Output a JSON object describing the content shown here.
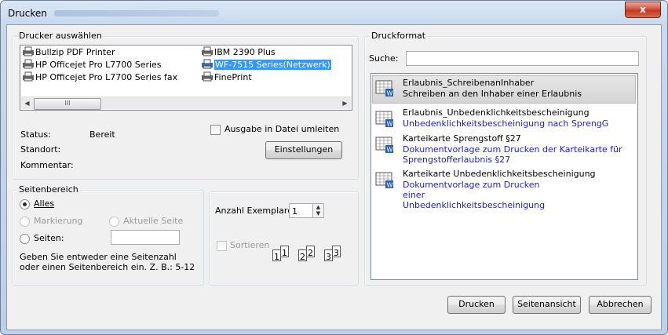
{
  "window": {
    "title": "Drucken",
    "close_label": "x"
  },
  "printer_group": {
    "legend": "Drucker auswählen",
    "printers_left": [
      "Bullzip PDF Printer",
      "HP Officejet Pro L7700 Series",
      "HP Officejet Pro L7700 Series fax"
    ],
    "printers_right": [
      "IBM 2390 Plus",
      "WF-7515 Series(Netzwerk)",
      "FinePrint"
    ],
    "selected": "WF-7515 Series(Netzwerk)",
    "scroll_thumb": "III",
    "status_label": "Status:",
    "status_value": "Bereit",
    "location_label": "Standort:",
    "comment_label": "Kommentar:",
    "print_to_file_label": "Ausgabe in Datei umleiten",
    "settings_button": "Einstellungen"
  },
  "range_group": {
    "legend": "Seitenbereich",
    "all_label": "Alles",
    "selection_label": "Markierung",
    "current_page_label": "Aktuelle Seite",
    "pages_label": "Seiten:",
    "pages_value": "",
    "hint": "Geben Sie entweder eine Seitenzahl oder einen Seitenbereich ein. Z. B.: 5-12",
    "selected": "all"
  },
  "copies": {
    "label": "Anzahl Exemplare:",
    "value": "1",
    "collate_label": "Sortieren",
    "page_numbers": [
      "1",
      "1",
      "2",
      "2",
      "3",
      "3"
    ]
  },
  "format_group": {
    "legend": "Druckformat",
    "search_label": "Suche:",
    "search_value": "",
    "items": [
      {
        "name": "Erlaubnis_SchreibenanInhaber",
        "description": "Schreiben an den Inhaber einer Erlaubnis"
      },
      {
        "name": "Erlaubnis_Unbedenklichkeitsbescheinigung",
        "description": "Unbedenklichkeitsbescheinigung nach SprengG"
      },
      {
        "name": "Karteikarte Sprengstoff §27",
        "description": "Dokumentvorlage zum Drucken der Karteikarte für Sprengstofferlaubnis §27"
      },
      {
        "name": "Karteikarte Unbedenklichkeitsbescheinigung",
        "description": "Dokumentvorlage zum Drucken einer Unbedenklichkeitsbescheinigung"
      }
    ]
  },
  "buttons": {
    "print": "Drucken",
    "preview": "Seitenansicht",
    "cancel": "Abbrechen"
  },
  "colors": {
    "selection": "#3399ff",
    "description_text": "#1c1cd8",
    "close_button": "#c23a20"
  },
  "icons": {
    "printer": "printer-icon",
    "word_template": "word-document-icon",
    "close": "close-icon",
    "spin": "spin-arrows-icon"
  }
}
